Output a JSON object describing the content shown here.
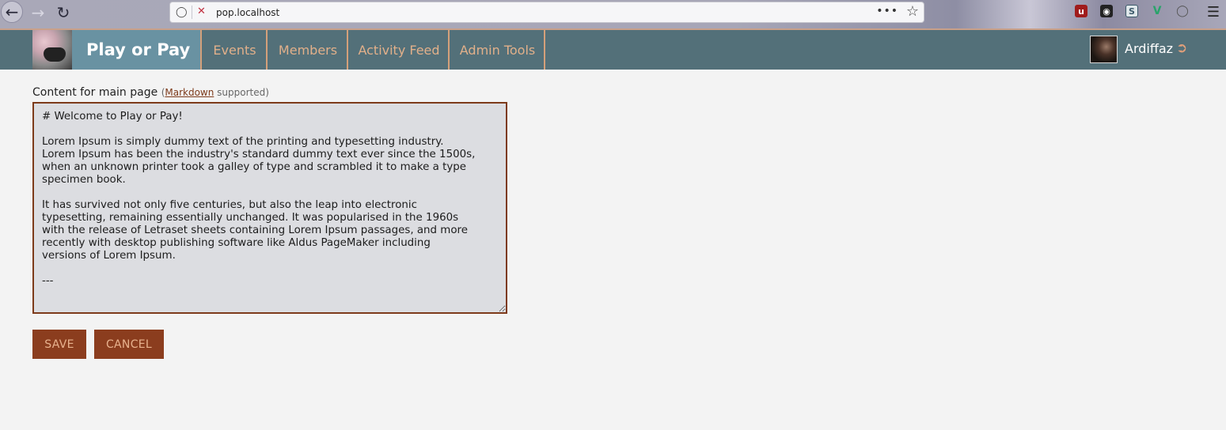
{
  "browser": {
    "url": "pop.localhost",
    "back_icon": "arrow-left-icon",
    "forward_icon": "arrow-right-icon",
    "reload_icon": "reload-icon",
    "more_glyph": "•••",
    "extensions": [
      {
        "name": "ublock-icon",
        "glyph": "uD",
        "color": "#a01c1c"
      },
      {
        "name": "ghostery-icon",
        "glyph": "◉",
        "color": "#222222"
      },
      {
        "name": "stylus-icon",
        "glyph": "S",
        "color": "#3c5a6a"
      },
      {
        "name": "vue-devtools-icon",
        "glyph": "V",
        "color": "#2aa36b"
      },
      {
        "name": "account-icon",
        "glyph": "◯",
        "color": "#555555"
      }
    ]
  },
  "nav": {
    "brand": "Play or Pay",
    "items": [
      {
        "label": "Events"
      },
      {
        "label": "Members"
      },
      {
        "label": "Activity Feed"
      },
      {
        "label": "Admin Tools"
      }
    ],
    "user_name": "Ardiffaz",
    "colors": {
      "bar": "#537079",
      "brand_bg": "#6992a2",
      "accent": "#d4a07a"
    }
  },
  "form": {
    "label": "Content for main page",
    "hint_open": "(",
    "hint_link": "Markdown",
    "hint_tail": " supported)",
    "content": "# Welcome to Play or Pay!\n\nLorem Ipsum is simply dummy text of the printing and typesetting industry.\nLorem Ipsum has been the industry's standard dummy text ever since the 1500s,\nwhen an unknown printer took a galley of type and scrambled it to make a type\nspecimen book.\n\nIt has survived not only five centuries, but also the leap into electronic\ntypesetting, remaining essentially unchanged. It was popularised in the 1960s\nwith the release of Letraset sheets containing Lorem Ipsum passages, and more\nrecently with desktop publishing software like Aldus PageMaker including\nversions of Lorem Ipsum.\n\n---",
    "save_label": "SAVE",
    "cancel_label": "CANCEL",
    "colors": {
      "button_bg": "#8b3d1e",
      "button_text": "#e8b28e",
      "editor_border": "#7d3a1a"
    }
  }
}
